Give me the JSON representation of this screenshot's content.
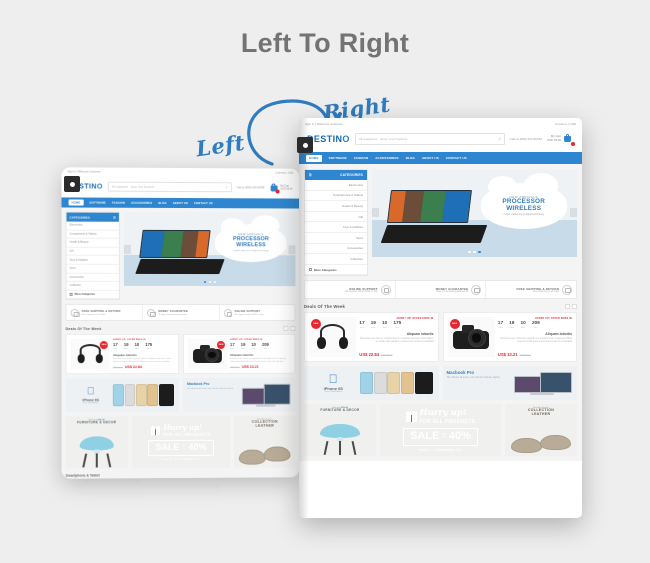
{
  "page": {
    "title": "Left To Right",
    "label_left": "Left",
    "label_right": "Right",
    "accent_blue": "#2f86d0",
    "background": "#eeeeee",
    "title_color": "#737373"
  },
  "site": {
    "brand": "DESTIN",
    "brand_tail": "O",
    "topbar_left": "Sign In   |   Welcome Customer",
    "topbar_right": "Currency   |   USD",
    "search_placeholder": "Enter Your Keyword",
    "search_category": "All Categories",
    "phone": "Call us  (800) 234-56789",
    "cart_label": "My Cart",
    "cart_total": "USD 29.00",
    "nav": [
      "HOME",
      "SOFTWARE",
      "FASHION",
      "ACCESSORIES",
      "BLOG",
      "ABOUT US",
      "CONTACT US"
    ],
    "nav_active": "HOME",
    "categories_title": "CATEGORIES",
    "categories": [
      "Electronics",
      "Smartphones & Tablets",
      "Health & Beauty",
      "Gift",
      "Toys & Hobbies",
      "Sport",
      "Accessories",
      "Collection"
    ],
    "categories_more": "More Categories",
    "hero": {
      "eyebrow": "NEW ARRIVALS",
      "headline_1": "PROCESSOR",
      "headline_2": "WIRELESS",
      "subline": "modern tablet era of digital technology",
      "prev": "‹",
      "next": "›"
    },
    "features": [
      {
        "title": "FREE SHIPPING & RETURN",
        "sub": "Free shipping on all order"
      },
      {
        "title": "MONEY GUARANTEE",
        "sub": "30 days money back guarantee"
      },
      {
        "title": "ONLINE SUPPORT",
        "sub": "We support online 24/24 on day"
      }
    ],
    "deals_title": "Deals Of The Week",
    "deals": [
      {
        "hurry": "HURRY UP! OFFER ENDS IN",
        "timer": [
          {
            "value": "17",
            "label": "Days"
          },
          {
            "value": "19",
            "label": "Hours"
          },
          {
            "value": "10",
            "label": "Mins"
          },
          {
            "value": "175",
            "label": "Secs"
          }
        ],
        "badge": "SALE",
        "name": "Aliquam lobortis",
        "desc": "Duis aute irure dolor in reprehenderit in voluptate velit esse cillum dolore eu fugiat nulla pariatur excepteur sint occaecat cupidatat.",
        "old_price": "US$ 45.10",
        "new_price": "US$ 22.84",
        "image": "headphone"
      },
      {
        "hurry": "HURRY UP! OFFER ENDS IN",
        "timer": [
          {
            "value": "17",
            "label": "Days"
          },
          {
            "value": "19",
            "label": "Hours"
          },
          {
            "value": "10",
            "label": "Mins"
          },
          {
            "value": "209",
            "label": "Secs"
          }
        ],
        "badge": "SALE",
        "name": "Aliquam lobortis",
        "desc": "Excepteur sint occaecat cupidatat non proident sunt in culpa qui officia deserunt mollit anim id est laborum sed ut perspiciatis.",
        "old_price": "US$ 28.00",
        "new_price": "US$ 13.21",
        "image": "camera"
      }
    ],
    "promos": [
      {
        "title": "Macbook Pro",
        "sub": "The ultimate all-in-one, now with the ultimate display"
      },
      {
        "title": "iPhone 6S",
        "sub": "Rose Gold Edition"
      }
    ],
    "strip": {
      "leather": {
        "eyebrow": "Best Men Fashion",
        "line1": "COLLECTION",
        "line2": "LEATHER"
      },
      "sale": {
        "hurry": "Hurry up!",
        "for_all": "FOR ALL PRODUCTS",
        "sale_word": "SALE",
        "up_to_1": "UP",
        "up_to_2": "TO",
        "percent": "40%",
        "dates": "FROM 14 - 21 DECEMBER, 2016"
      },
      "furniture": {
        "eyebrow_a": "Sale up to ",
        "eyebrow_b": "30% off",
        "line1": "FURNITURE & DECOR"
      }
    },
    "bottom_section": "Smartphone & Tablet"
  }
}
